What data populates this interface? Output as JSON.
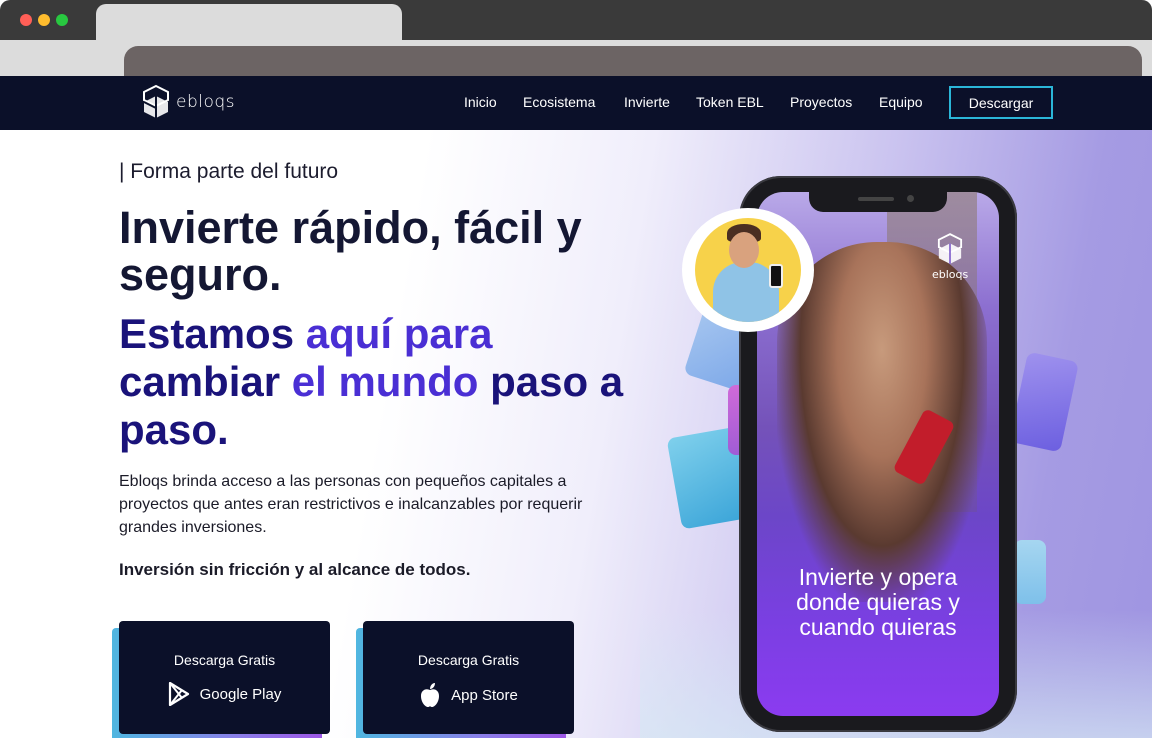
{
  "nav": {
    "logo_text": "ebloqs",
    "links": [
      "Inicio",
      "Ecosistema",
      "Invierte",
      "Token EBL",
      "Proyectos",
      "Equipo"
    ],
    "cta": "Descargar"
  },
  "hero": {
    "kicker": "| Forma parte del futuro",
    "title": "Invierte rápido, fácil y seguro.",
    "subtitle_parts": [
      "Estamos ",
      "aquí para",
      " cambiar ",
      "el mundo",
      " paso a paso."
    ],
    "description": "Ebloqs brinda acceso a las personas con pequeños capitales a proyectos que antes eran restrictivos e inalcanzables por requerir grandes inversiones.",
    "tagline": "Inversión sin fricción y al alcance de todos."
  },
  "stores": [
    {
      "top": "Descarga Gratis",
      "label": "Google Play",
      "icon": "google-play-icon"
    },
    {
      "top": "Descarga Gratis",
      "label": "App Store",
      "icon": "apple-icon"
    }
  ],
  "phone": {
    "logo_text": "ebloqs",
    "caption_lines": [
      "Invierte y opera",
      "donde quieras y",
      "cuando quieras"
    ]
  },
  "colors": {
    "nav_bg": "#0b1029",
    "accent_cyan": "#2bb6d8",
    "headline_dark": "#141733",
    "headline_indigo": "#1a137a",
    "headline_violet": "#4a2fd4"
  }
}
